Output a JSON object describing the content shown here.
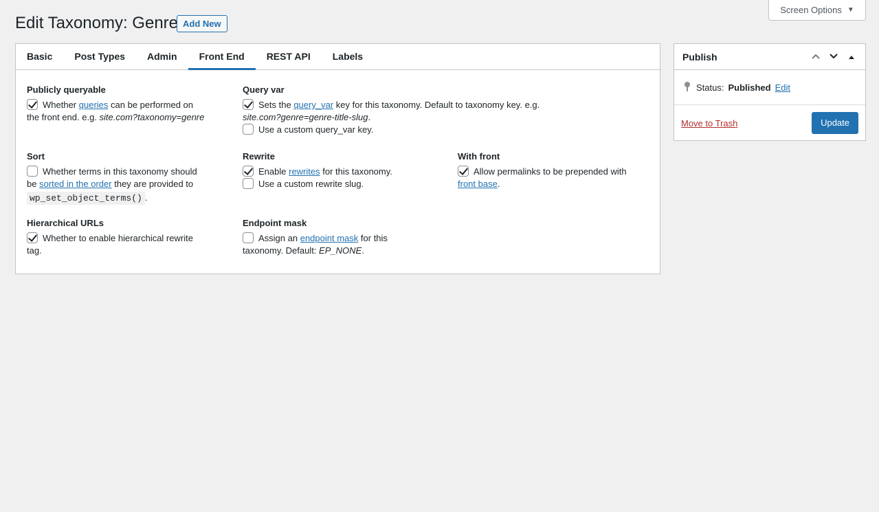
{
  "screen_options": {
    "label": "Screen Options"
  },
  "header": {
    "title": "Edit Taxonomy: Genres",
    "add_new": "Add New"
  },
  "tabs": [
    {
      "label": "Basic"
    },
    {
      "label": "Post Types"
    },
    {
      "label": "Admin"
    },
    {
      "label": "Front End",
      "active": true
    },
    {
      "label": "REST API"
    },
    {
      "label": "Labels"
    }
  ],
  "fields": {
    "publicly_queryable": {
      "label": "Publicly queryable",
      "checked": true,
      "text_before": "Whether",
      "link": "queries",
      "text_after": "can be performed on",
      "line2": "the front end. e.g.",
      "example": "site.com?taxonomy=genre"
    },
    "query_var": {
      "label": "Query var",
      "checked": true,
      "text_before": "Sets the",
      "link": "query_var",
      "text_after": "key for this taxonomy. Default to taxonomy key. e.g.",
      "example": "site.com?genre=genre-title-slug",
      "example_suffix": ".",
      "custom_checked": false,
      "custom_label": "Use a custom query_var key."
    },
    "sort": {
      "label": "Sort",
      "checked": false,
      "line1": "Whether terms in this taxonomy should",
      "be": "be",
      "link": "sorted in the order",
      "text_after": "they are provided to",
      "code": "wp_set_object_terms()",
      "code_suffix": "."
    },
    "rewrite": {
      "label": "Rewrite",
      "checked": true,
      "text_before": "Enable",
      "link": "rewrites",
      "text_after": "for this taxonomy.",
      "custom_checked": false,
      "custom_label": "Use a custom rewrite slug."
    },
    "with_front": {
      "label": "With front",
      "checked": true,
      "text": "Allow permalinks to be prepended with",
      "link": "front base",
      "suffix": "."
    },
    "hierarchical_urls": {
      "label": "Hierarchical URLs",
      "checked": true,
      "text": "Whether to enable hierarchical rewrite",
      "line2": "tag."
    },
    "endpoint_mask": {
      "label": "Endpoint mask",
      "checked": false,
      "text_before": "Assign an",
      "link": "endpoint mask",
      "text_after": "for this",
      "line2": "taxonomy. Default:",
      "default_value": "EP_NONE",
      "suffix": "."
    }
  },
  "publish": {
    "title": "Publish",
    "status_label": "Status:",
    "status_value": "Published",
    "edit_link": "Edit",
    "trash_link": "Move to Trash",
    "update_button": "Update"
  }
}
